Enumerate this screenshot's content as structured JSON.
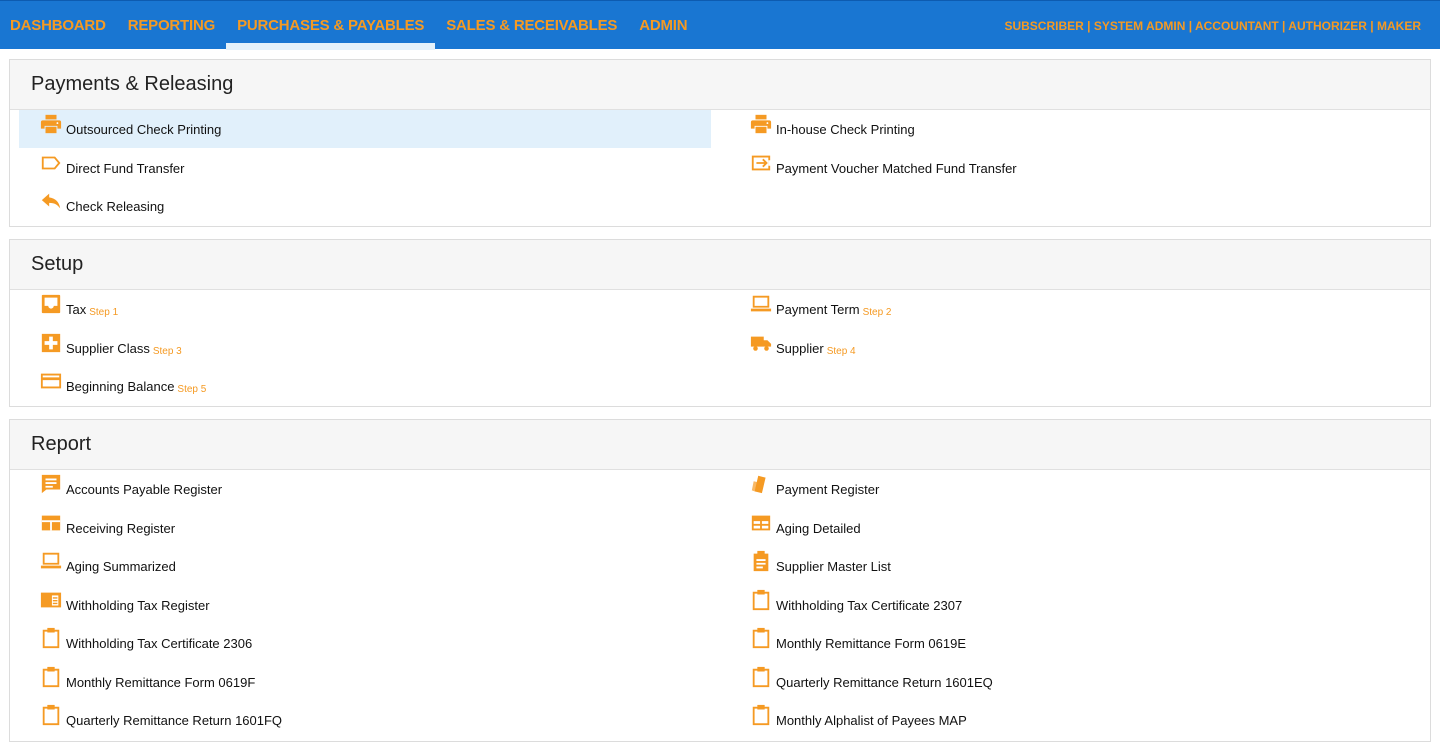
{
  "nav": {
    "items": [
      {
        "label": "DASHBOARD"
      },
      {
        "label": "REPORTING"
      },
      {
        "label": "PURCHASES & PAYABLES"
      },
      {
        "label": "SALES & RECEIVABLES"
      },
      {
        "label": "ADMIN"
      }
    ],
    "roles": "SUBSCRIBER | SYSTEM ADMIN | ACCOUNTANT | AUTHORIZER | MAKER"
  },
  "colors": {
    "accent": "#f59a23",
    "topbar": "#1976d2",
    "highlight": "#e1f0fb"
  },
  "payments": {
    "title": "Payments & Releasing",
    "items": [
      {
        "label": "Outsourced Check Printing",
        "icon": "printer-icon"
      },
      {
        "label": "In-house Check Printing",
        "icon": "printer-icon"
      },
      {
        "label": "Direct Fund Transfer",
        "icon": "tag-icon"
      },
      {
        "label": "Payment Voucher Matched Fund Transfer",
        "icon": "transfer-icon"
      },
      {
        "label": "Check Releasing",
        "icon": "reply-icon"
      }
    ]
  },
  "setup": {
    "title": "Setup",
    "items": [
      {
        "label": "Tax",
        "step": "Step 1",
        "icon": "inbox-icon"
      },
      {
        "label": "Payment Term",
        "step": "Step 2",
        "icon": "laptop-icon"
      },
      {
        "label": "Supplier Class",
        "step": "Step 3",
        "icon": "puzzle-icon"
      },
      {
        "label": "Supplier",
        "step": "Step 4",
        "icon": "truck-icon"
      },
      {
        "label": "Beginning Balance",
        "step": "Step 5",
        "icon": "credit-card-icon"
      }
    ]
  },
  "report": {
    "title": "Report",
    "items": [
      {
        "label": "Accounts Payable Register",
        "icon": "message-icon"
      },
      {
        "label": "Payment Register",
        "icon": "cards-icon"
      },
      {
        "label": "Receiving Register",
        "icon": "table-icon"
      },
      {
        "label": "Aging Detailed",
        "icon": "calendar-icon"
      },
      {
        "label": "Aging Summarized",
        "icon": "laptop-icon"
      },
      {
        "label": "Supplier Master List",
        "icon": "clipboard-list-icon"
      },
      {
        "label": "Withholding Tax Register",
        "icon": "book-icon"
      },
      {
        "label": "Withholding Tax Certificate 2307",
        "icon": "clipboard-icon"
      },
      {
        "label": "Withholding Tax Certificate 2306",
        "icon": "clipboard-icon"
      },
      {
        "label": "Monthly Remittance Form 0619E",
        "icon": "clipboard-icon"
      },
      {
        "label": "Monthly Remittance Form 0619F",
        "icon": "clipboard-icon"
      },
      {
        "label": "Quarterly Remittance Return 1601EQ",
        "icon": "clipboard-icon"
      },
      {
        "label": "Quarterly Remittance Return 1601FQ",
        "icon": "clipboard-icon"
      },
      {
        "label": "Monthly Alphalist of Payees MAP",
        "icon": "clipboard-icon"
      }
    ]
  }
}
